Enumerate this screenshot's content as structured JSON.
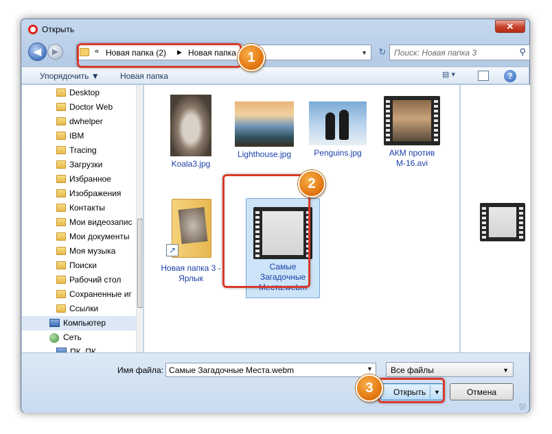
{
  "window": {
    "title": "Открыть",
    "close_label": "✕"
  },
  "navbar": {
    "back_label": "◀",
    "forward_label": "▶",
    "breadcrumb_overflow": "«",
    "breadcrumb": [
      "Новая папка (2)",
      "Новая папка 3"
    ],
    "separator": "▶",
    "dropdown": "▼",
    "refresh_label": "↻",
    "search_placeholder": "Поиск: Новая папка 3",
    "search_icon": "⚲"
  },
  "toolbar": {
    "organize_label": "Упорядочить ▼",
    "new_folder_label": "Новая папка",
    "view_label": "▤ ▾",
    "help_label": "?"
  },
  "sidebar": {
    "items": [
      {
        "label": "Desktop",
        "icon": "folder-icon"
      },
      {
        "label": "Doctor Web",
        "icon": "folder-icon"
      },
      {
        "label": "dwhelper",
        "icon": "folder-icon"
      },
      {
        "label": "IBM",
        "icon": "folder-icon"
      },
      {
        "label": "Tracing",
        "icon": "folder-icon"
      },
      {
        "label": "Загрузки",
        "icon": "folder-icon"
      },
      {
        "label": "Избранное",
        "icon": "folder-icon"
      },
      {
        "label": "Изображения",
        "icon": "folder-icon"
      },
      {
        "label": "Контакты",
        "icon": "folder-icon"
      },
      {
        "label": "Мои видеозапис",
        "icon": "folder-icon"
      },
      {
        "label": "Мои документы",
        "icon": "folder-icon"
      },
      {
        "label": "Моя музыка",
        "icon": "folder-icon"
      },
      {
        "label": "Поиски",
        "icon": "folder-icon"
      },
      {
        "label": "Рабочий стол",
        "icon": "folder-icon"
      },
      {
        "label": "Сохраненные иг",
        "icon": "folder-icon"
      },
      {
        "label": "Ссылки",
        "icon": "folder-icon"
      },
      {
        "label": "Компьютер",
        "icon": "computer-icon"
      },
      {
        "label": "Сеть",
        "icon": "network-icon"
      },
      {
        "label": "ПК_ПК",
        "icon": "computer-icon"
      }
    ]
  },
  "files": [
    {
      "name": "Koala3.jpg",
      "kind": "image"
    },
    {
      "name": "Lighthouse.jpg",
      "kind": "image"
    },
    {
      "name": "Penguins.jpg",
      "kind": "image"
    },
    {
      "name": "АКМ против М-16.avi",
      "kind": "video"
    },
    {
      "name": "Новая папка 3 - Ярлык",
      "kind": "shortcut"
    },
    {
      "name": "Самые Загадочные Места.webm",
      "kind": "video",
      "selected": true
    }
  ],
  "footer": {
    "filename_label": "Имя файла:",
    "filename_value": "Самые Загадочные Места.webm",
    "filetype": "Все файлы",
    "open_label": "Открыть",
    "cancel_label": "Отмена"
  },
  "markers": [
    "1",
    "2",
    "3"
  ],
  "colors": {
    "highlight": "#d83a2a",
    "marker": "#e57a14",
    "link_text": "#1a3fa8"
  }
}
